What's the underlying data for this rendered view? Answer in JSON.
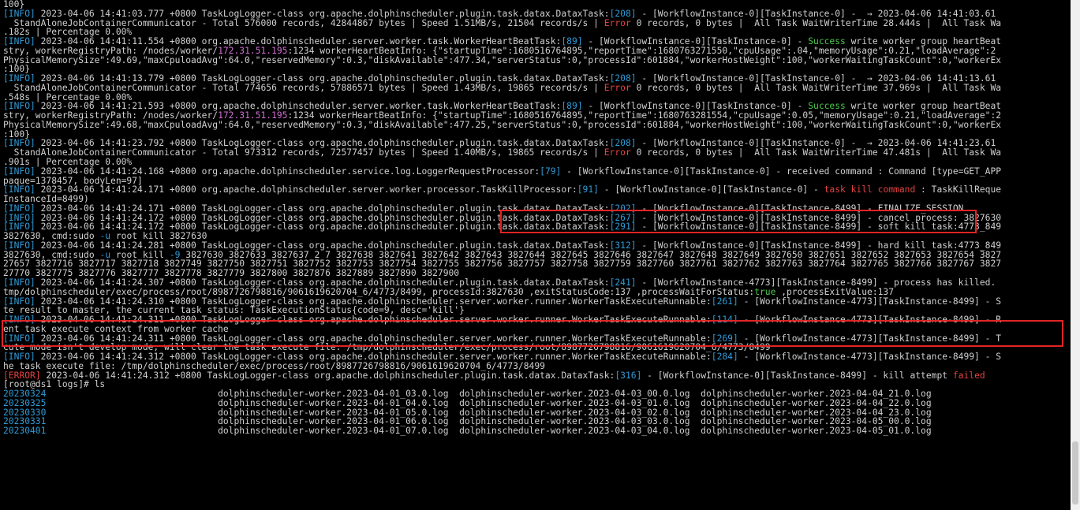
{
  "terminal": {
    "lines": [
      [
        {
          "t": "100}"
        }
      ],
      [
        {
          "t": "[INFO]",
          "c": "blue"
        },
        {
          "t": " 2023-04-06 14:41:03.777 +0800 TaskLogLogger-class org.apache.dolphinscheduler.plugin.task.datax.DataxTask:"
        },
        {
          "t": "[208]",
          "c": "blue"
        },
        {
          "t": " - [WorkflowInstance-0][TaskInstance-0] -  → 2023-04-06 14:41:03.61"
        }
      ],
      [
        {
          "t": "  StandAloneJobContainerCommunicator - Total 576000 records, 42844867 bytes | Speed 1.51MB/s, 21504 records/s | "
        },
        {
          "t": "Error",
          "c": "red"
        },
        {
          "t": " 0 records, 0 bytes |  All Task WaitWriterTime 28.444s |  All Task Wa"
        }
      ],
      [
        {
          "t": ".182s | Percentage 0.00%"
        }
      ],
      [
        {
          "t": "[INFO]",
          "c": "blue"
        },
        {
          "t": " 2023-04-06 14:41:11.554 +0800 org.apache.dolphinscheduler.server.worker.task.WorkerHeartBeatTask:"
        },
        {
          "t": "[89]",
          "c": "blue"
        },
        {
          "t": " - [WorkflowInstance-0][TaskInstance-0] - "
        },
        {
          "t": "Success",
          "c": "green"
        },
        {
          "t": " write worker group heartBeat"
        }
      ],
      [
        {
          "t": "stry, workerRegistryPath: /nodes/worker/"
        },
        {
          "t": "172.31.51.195",
          "c": "magenta"
        },
        {
          "t": ":1234 workerHeartBeatInfo: {\"startupTime\":1680516764895,\"reportTime\":1680763271550,\"cpuUsage\":.04,\"memoryUsage\":0.21,\"loadAverage\":2"
        }
      ],
      [
        {
          "t": "PhysicalMemorySize\":49.69,\"maxCpuloadAvg\":64.0,\"reservedMemory\":0.3,\"diskAvailable\":477.34,\"serverStatus\":0,\"processId\":601884,\"workerHostWeight\":100,\"workerWaitingTaskCount\":0,\"workerEx"
        }
      ],
      [
        {
          "t": ":100}"
        }
      ],
      [
        {
          "t": "[INFO]",
          "c": "blue"
        },
        {
          "t": " 2023-04-06 14:41:13.779 +0800 TaskLogLogger-class org.apache.dolphinscheduler.plugin.task.datax.DataxTask:"
        },
        {
          "t": "[208]",
          "c": "blue"
        },
        {
          "t": " - [WorkflowInstance-0][TaskInstance-0] -  → 2023-04-06 14:41:13.61"
        }
      ],
      [
        {
          "t": "  StandAloneJobContainerCommunicator - Total 774656 records, 57886571 bytes | Speed 1.43MB/s, 19865 records/s | "
        },
        {
          "t": "Error",
          "c": "red"
        },
        {
          "t": " 0 records, 0 bytes |  All Task WaitWriterTime 37.969s |  All Task Wa"
        }
      ],
      [
        {
          "t": ".548s | Percentage 0.00%"
        }
      ],
      [
        {
          "t": "[INFO]",
          "c": "blue"
        },
        {
          "t": " 2023-04-06 14:41:21.593 +0800 org.apache.dolphinscheduler.server.worker.task.WorkerHeartBeatTask:"
        },
        {
          "t": "[89]",
          "c": "blue"
        },
        {
          "t": " - [WorkflowInstance-0][TaskInstance-0] - "
        },
        {
          "t": "Success",
          "c": "green"
        },
        {
          "t": " write worker group heartBeat"
        }
      ],
      [
        {
          "t": "stry, workerRegistryPath: /nodes/worker/"
        },
        {
          "t": "172.31.51.195",
          "c": "magenta"
        },
        {
          "t": ":1234 workerHeartBeatInfo: {\"startupTime\":1680516764895,\"reportTime\":1680763281554,\"cpuUsage\":0.05,\"memoryUsage\":0.21,\"loadAverage\":2"
        }
      ],
      [
        {
          "t": "PhysicalMemorySize\":49.68,\"maxCpuloadAvg\":64.0,\"reservedMemory\":0.3,\"diskAvailable\":477.25,\"serverStatus\":0,\"processId\":601884,\"workerHostWeight\":100,\"workerWaitingTaskCount\":0,\"workerEx"
        }
      ],
      [
        {
          "t": ":100}"
        }
      ],
      [
        {
          "t": "[INFO]",
          "c": "blue"
        },
        {
          "t": " 2023-04-06 14:41:23.792 +0800 TaskLogLogger-class org.apache.dolphinscheduler.plugin.task.datax.DataxTask:"
        },
        {
          "t": "[208]",
          "c": "blue"
        },
        {
          "t": " - [WorkflowInstance-0][TaskInstance-0] -  → 2023-04-06 14:41:23.61"
        }
      ],
      [
        {
          "t": "  StandAloneJobContainerCommunicator - Total 973312 records, 72577457 bytes | Speed 1.40MB/s, 19865 records/s | "
        },
        {
          "t": "Error",
          "c": "red"
        },
        {
          "t": " 0 records, 0 bytes |  All Task WaitWriterTime 47.481s |  All Task Wa"
        }
      ],
      [
        {
          "t": ".901s | Percentage 0.00%"
        }
      ],
      [
        {
          "t": "[INFO]",
          "c": "blue"
        },
        {
          "t": " 2023-04-06 14:41:24.168 +0800 org.apache.dolphinscheduler.service.log.LoggerRequestProcessor:"
        },
        {
          "t": "[79]",
          "c": "blue"
        },
        {
          "t": " - [WorkflowInstance-0][TaskInstance-0] - received command : Command [type=GET_APP"
        }
      ],
      [
        {
          "t": "paque=1378457, bodyLen=97]"
        }
      ],
      [
        {
          "t": "[INFO]",
          "c": "blue"
        },
        {
          "t": " 2023-04-06 14:41:24.171 +0800 org.apache.dolphinscheduler.server.worker.processor.TaskKillProcessor:"
        },
        {
          "t": "[91]",
          "c": "blue"
        },
        {
          "t": " - [WorkflowInstance-0][TaskInstance-0] - "
        },
        {
          "t": "task kill command",
          "c": "red"
        },
        {
          "t": " : TaskKillReque"
        }
      ],
      [
        {
          "t": "InstanceId=8499)"
        }
      ],
      [
        {
          "t": "[INFO]",
          "c": "blue"
        },
        {
          "t": " 2023-04-06 14:41:24.171 +0800 TaskLogLogger-class org.apache.dolphinscheduler.plugin.task.datax.DataxTask:"
        },
        {
          "t": "[202]",
          "c": "blue"
        },
        {
          "t": " - [WorkflowInstance-0][TaskInstance-8499] - FINALIZE_SESSION"
        }
      ],
      [
        {
          "t": "[INFO]",
          "c": "blue"
        },
        {
          "t": " 2023-04-06 14:41:24.172 +0800 TaskLogLogger-class org.apache.dolphinscheduler.plugin.task.datax.DataxTask:"
        },
        {
          "t": "[267]",
          "c": "blue"
        },
        {
          "t": " - [WorkflowInstance-0][TaskInstance-8499] - cancel process: 3827630"
        }
      ],
      [
        {
          "t": "[INFO]",
          "c": "blue"
        },
        {
          "t": " 2023-04-06 14:41:24.172 +0800 TaskLogLogger-class org.apache.dolphinscheduler.plugin.task.datax.DataxTask:"
        },
        {
          "t": "[291]",
          "c": "blue"
        },
        {
          "t": " - [WorkflowInstance-0][TaskInstance-8499] - soft kill task:4773_849"
        }
      ],
      [
        {
          "t": "3827630, cmd:sudo "
        },
        {
          "t": "-u",
          "c": "blue"
        },
        {
          "t": " root kill 3827630"
        }
      ],
      [
        {
          "t": "[INFO]",
          "c": "blue"
        },
        {
          "t": " 2023-04-06 14:41:24.281 +0800 TaskLogLogger-class org.apache.dolphinscheduler.plugin.task.datax.DataxTask:"
        },
        {
          "t": "[312]",
          "c": "blue"
        },
        {
          "t": " - [WorkflowInstance-0][TaskInstance-8499] - hard kill task:4773_849"
        }
      ],
      [
        {
          "t": "3827630, cmd:sudo "
        },
        {
          "t": "-u",
          "c": "blue"
        },
        {
          "t": " root kill "
        },
        {
          "t": "-9",
          "c": "blue"
        },
        {
          "t": " 3827630 3827633 3827637 2 7 3827638 3827641 3827642 3827643 3827644 3827645 3827646 3827647 3827648 3827649 3827650 3827651 3827652 3827653 3827654 3827"
        }
      ],
      [
        {
          "t": "27657 3827716 3827717 3827718 3827749 3827750 3827751 3827752 3827753 3827754 3827755 3827756 3827757 3827758 3827759 3827760 3827761 3827762 3827763 3827764 3827765 3827766 3827767 3827"
        }
      ],
      [
        {
          "t": "27770 3827775 3827776 3827777 3827778 3827779 3827800 3827876 3827889 3827890 3827900"
        }
      ],
      [
        {
          "t": "[INFO]",
          "c": "blue"
        },
        {
          "t": " 2023-04-06 14:41:24.307 +0800 TaskLogLogger-class org.apache.dolphinscheduler.plugin.task.datax.DataxTask:"
        },
        {
          "t": "[241]",
          "c": "blue"
        },
        {
          "t": " - [WorkflowInstance-4773][TaskInstance-8499] - process has killed."
        }
      ],
      [
        {
          "t": "tmp/dolphinscheduler/exec/process/root/8987726798816/9061619620704_6/4773/8499, processId:3827630 ,exitStatusCode:137 ,processWaitForStatus:"
        },
        {
          "t": "true",
          "c": "green"
        },
        {
          "t": " ,processExitValue:137"
        }
      ],
      [
        {
          "t": "[INFO]",
          "c": "blue"
        },
        {
          "t": " 2023-04-06 14:41:24.310 +0800 TaskLogLogger-class org.apache.dolphinscheduler.server.worker.runner.WorkerTaskExecuteRunnable:"
        },
        {
          "t": "[261]",
          "c": "blue"
        },
        {
          "t": " - [WorkflowInstance-4773][TaskInstance-8499] - S"
        }
      ],
      [
        {
          "t": "te result to master, the current task status: TaskExecutionStatus{code=9, desc='kill'}"
        }
      ],
      [
        {
          "t": "[INFO]",
          "c": "blue"
        },
        {
          "t": " 2023-04-06 14:41:24.311 +0800 TaskLogLogger-class org.apache.dolphinscheduler.server.worker.runner.WorkerTaskExecuteRunnable:"
        },
        {
          "t": "[114]",
          "c": "blue"
        },
        {
          "t": " - [WorkflowInstance-4773][TaskInstance-8499] - R"
        }
      ],
      [
        {
          "t": "ent task execute context from worker cache"
        }
      ],
      [
        {
          "t": "[INFO]",
          "c": "blue"
        },
        {
          "t": " 2023-04-06 14:41:24.311 +0800 TaskLogLogger-class org.apache.dolphinscheduler.server.worker.runner.WorkerTaskExecuteRunnable:"
        },
        {
          "t": "[269]",
          "c": "blue"
        },
        {
          "t": " - [WorkflowInstance-4773][TaskInstance-8499] - T"
        }
      ],
      [
        {
          "t": "cute mode isn't develop mode, will clear the task execute file: /tmp/dolphinscheduler/exec/process/root/8987726798816/9061619620704_6/4773/8499"
        }
      ],
      [
        {
          "t": "[INFO]",
          "c": "blue"
        },
        {
          "t": " 2023-04-06 14:41:24.312 +0800 TaskLogLogger-class org.apache.dolphinscheduler.server.worker.runner.WorkerTaskExecuteRunnable:"
        },
        {
          "t": "[284]",
          "c": "blue"
        },
        {
          "t": " - [WorkflowInstance-4773][TaskInstance-8499] - S"
        }
      ],
      [
        {
          "t": "he task execute file: /tmp/dolphinscheduler/exec/process/root/8987726798816/9061619620704_6/4773/8499"
        }
      ],
      [
        {
          "t": "[ERROR]",
          "c": "red"
        },
        {
          "t": " 2023-04-06 14:41:24.312 +0800 TaskLogLogger-class org.apache.dolphinscheduler.plugin.task.datax.DataxTask:"
        },
        {
          "t": "[316]",
          "c": "blue"
        },
        {
          "t": " - [WorkflowInstance-0][TaskInstance-8499] - kill attempt "
        },
        {
          "t": "failed",
          "c": "red"
        }
      ],
      [
        {
          "t": "[root@ds1 logs]# ls"
        }
      ],
      [
        {
          "t": "20230324",
          "c": "blue"
        },
        {
          "t": "                                dolphinscheduler-worker.2023-04-01_03.0.log  dolphinscheduler-worker.2023-04-03_00.0.log  dolphinscheduler-worker.2023-04-04_21.0.log"
        }
      ],
      [
        {
          "t": "20230325",
          "c": "blue"
        },
        {
          "t": "                                dolphinscheduler-worker.2023-04-01_04.0.log  dolphinscheduler-worker.2023-04-03_01.0.log  dolphinscheduler-worker.2023-04-04_22.0.log"
        }
      ],
      [
        {
          "t": "20230330",
          "c": "blue"
        },
        {
          "t": "                                dolphinscheduler-worker.2023-04-01_05.0.log  dolphinscheduler-worker.2023-04-03_02.0.log  dolphinscheduler-worker.2023-04-04_23.0.log"
        }
      ],
      [
        {
          "t": "20230331",
          "c": "blue"
        },
        {
          "t": "                                dolphinscheduler-worker.2023-04-01_06.0.log  dolphinscheduler-worker.2023-04-03_03.0.log  dolphinscheduler-worker.2023-04-05_00.0.log"
        }
      ],
      [
        {
          "t": "20230401",
          "c": "blue"
        },
        {
          "t": "                                dolphinscheduler-worker.2023-04-01_07.0.log  dolphinscheduler-worker.2023-04-03_04.0.log  dolphinscheduler-worker.2023-04-05_01.0.log"
        }
      ]
    ]
  },
  "colors": {
    "background": "#000000",
    "text": "#d0d0d0",
    "blue": "#2f9bd8",
    "red": "#e34242",
    "green": "#4cc94c",
    "magenta": "#d16fd1",
    "highlight_box": "#e12424"
  }
}
